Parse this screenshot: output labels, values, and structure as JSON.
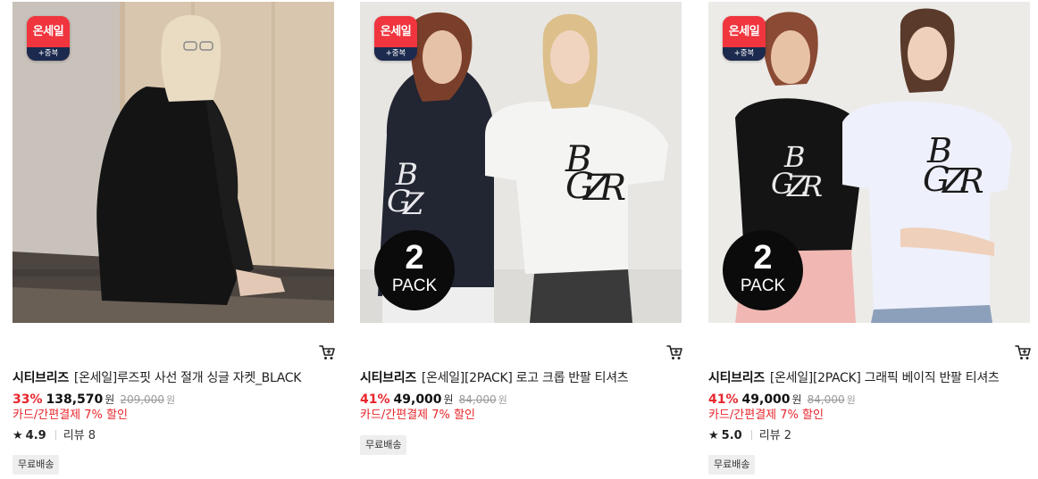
{
  "badge": {
    "top": "온세일",
    "bottom": "+중복"
  },
  "products": [
    {
      "brand": "시티브리즈",
      "name": "[온세일]루즈핏 사선 절개 싱글 자켓_BLACK",
      "discount": "33%",
      "price": "138,570",
      "price_unit": "원",
      "original_price": "209,000",
      "original_unit": "원",
      "promo": "카드/간편결제 7% 할인",
      "rating": "4.9",
      "review_text": "리뷰 8",
      "shipping": "무료배송",
      "pack": null,
      "image": "model in black jacket seated by wooden wall"
    },
    {
      "brand": "시티브리즈",
      "name": "[온세일][2PACK] 로고 크롭 반팔 티셔츠",
      "discount": "41%",
      "price": "49,000",
      "price_unit": "원",
      "original_price": "84,000",
      "original_unit": "원",
      "promo": "카드/간편결제 7% 할인",
      "rating": null,
      "review_text": null,
      "shipping": "무료배송",
      "pack": {
        "num": "2",
        "label": "PACK"
      },
      "image": "two models in navy and white cropped logo tees"
    },
    {
      "brand": "시티브리즈",
      "name": "[온세일][2PACK] 그래픽 베이직 반팔 티셔츠",
      "discount": "41%",
      "price": "49,000",
      "price_unit": "원",
      "original_price": "84,000",
      "original_unit": "원",
      "promo": "카드/간편결제 7% 할인",
      "rating": "5.0",
      "review_text": "리뷰 2",
      "shipping": "무료배송",
      "pack": {
        "num": "2",
        "label": "PACK"
      },
      "image": "two models in black and white graphic tees"
    }
  ],
  "icons": {
    "cart": "cart-icon",
    "star": "star-icon"
  },
  "colors": {
    "discount": "#e8262c",
    "badge_red": "#f0353e",
    "badge_navy": "#1b2a4e"
  }
}
